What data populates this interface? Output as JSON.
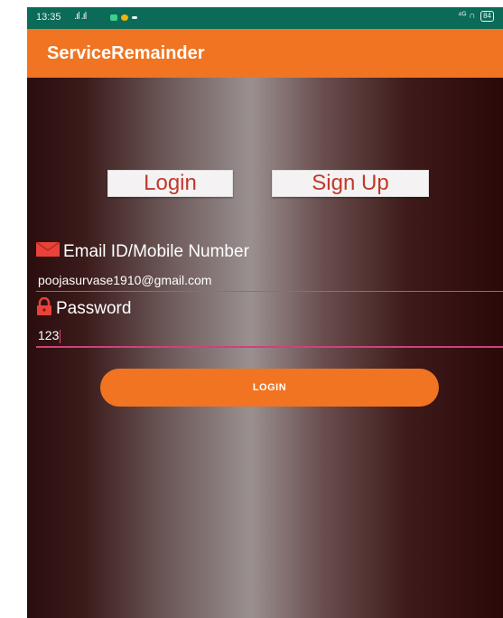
{
  "status_bar": {
    "time": "13:35",
    "signal": ".ıl .ıl",
    "battery": "84"
  },
  "app_bar": {
    "title": "ServiceRemainder"
  },
  "tabs": {
    "login": "Login",
    "signup": "Sign Up"
  },
  "form": {
    "email_label": "Email ID/Mobile Number",
    "email_value": "poojasurvase1910@gmail.com",
    "password_label": "Password",
    "password_value": "123"
  },
  "login_button": "LOGIN",
  "colors": {
    "status_bar": "#0b6b58",
    "app_bar": "#f07421",
    "button": "#f07421",
    "tab_text": "#c0392b",
    "icon": "#e8423a"
  },
  "icons": {
    "email": "envelope-icon",
    "password": "lock-icon"
  }
}
